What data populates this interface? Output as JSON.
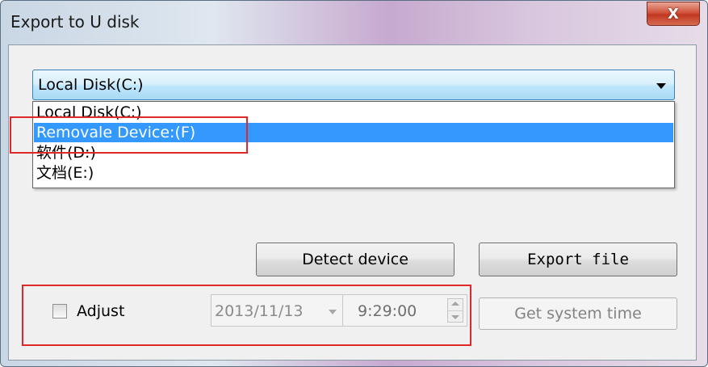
{
  "window": {
    "title": "Export to U disk",
    "close_label": "X"
  },
  "drive_select": {
    "selected": "Local Disk(C:)",
    "options": [
      "Local Disk(C:)",
      "Removale Device:(F)",
      "软件(D:)",
      "文档(E:)"
    ],
    "highlighted_index": 1
  },
  "buttons": {
    "detect": "Detect device",
    "export": "Export file",
    "system_time": "Get system time"
  },
  "adjust": {
    "label": "Adjust",
    "checked": false,
    "date": "2013/11/13",
    "time": "9:29:00"
  },
  "colors": {
    "highlight": "#3399ff",
    "annotation_box": "#e0282a"
  }
}
